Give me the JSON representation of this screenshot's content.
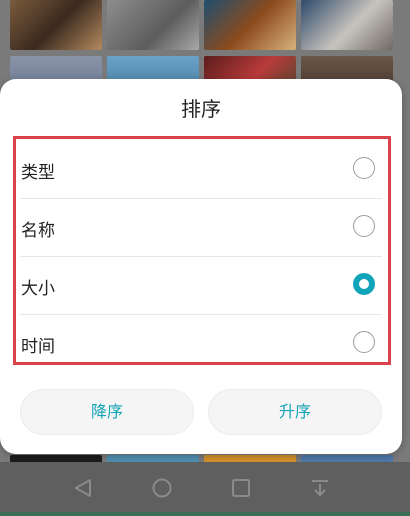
{
  "dialog": {
    "title": "排序",
    "options": [
      {
        "label": "类型",
        "selected": false
      },
      {
        "label": "名称",
        "selected": false
      },
      {
        "label": "大小",
        "selected": true
      },
      {
        "label": "时间",
        "selected": false
      }
    ],
    "buttons": {
      "descending": "降序",
      "ascending": "升序"
    }
  },
  "colors": {
    "accent": "#11a4b8",
    "highlight_border": "#d9434c"
  },
  "navbar": {
    "icons": [
      "back-icon",
      "home-icon",
      "recent-apps-icon",
      "notification-pull-icon"
    ]
  }
}
